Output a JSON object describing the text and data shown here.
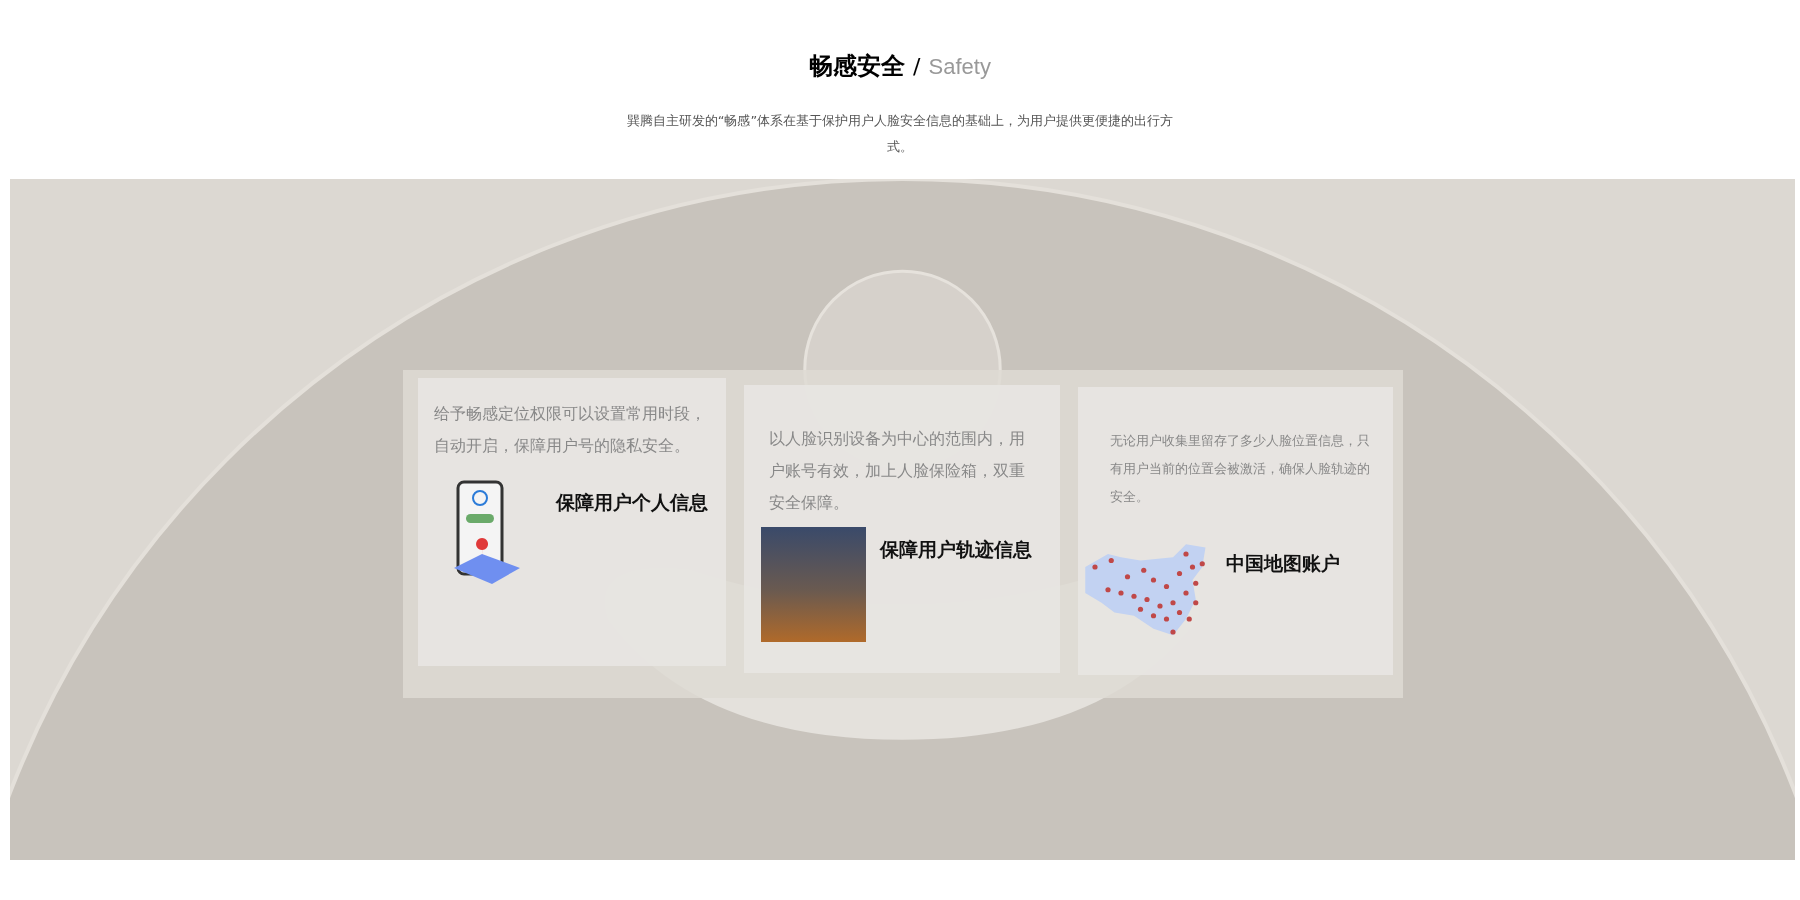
{
  "header": {
    "title": "畅感安全",
    "separator": "/",
    "subtitle": "Safety",
    "description": "巽腾自主研发的“畅感”体系在基于保护用户人脸安全信息的基础上，为用户提供更便捷的出行方式。"
  },
  "cards": [
    {
      "kind": "illustration",
      "text": "给予畅感定位权限可以设置常用时段，自动开启，保障用户号的隐私安全。",
      "title": "保障用户个人信息"
    },
    {
      "kind": "photo",
      "text": "以人脸识别设备为中心的范围内，用户账号有效，加上人脸保险箱，双重安全保障。",
      "title": "保障用户轨迹信息"
    },
    {
      "kind": "map",
      "text": "无论用户收集里留存了多少人脸位置信息，只有用户当前的位置会被激活，确保人脸轨迹的安全。",
      "title": "中国地图账户"
    }
  ]
}
